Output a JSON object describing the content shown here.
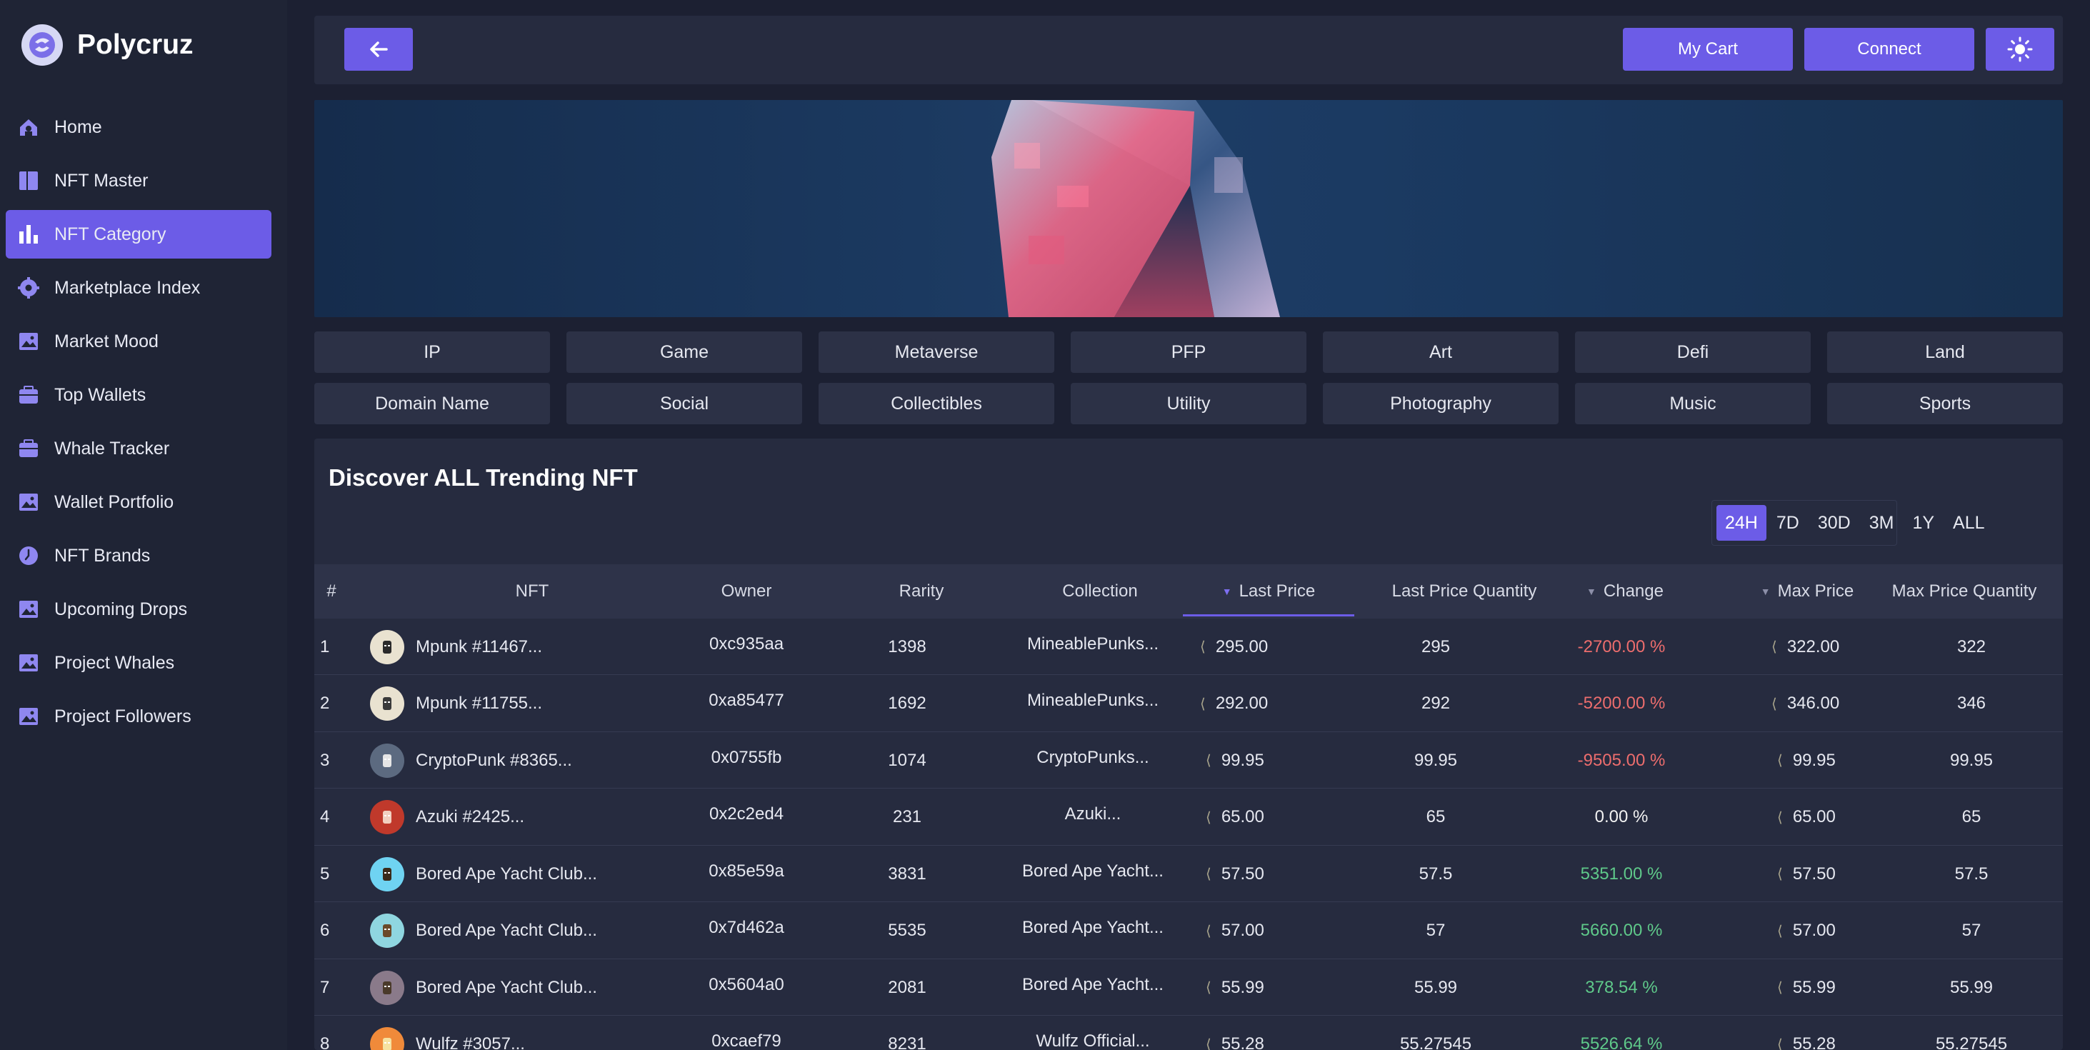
{
  "brand": {
    "name": "Polycruz"
  },
  "sidebar": {
    "items": [
      {
        "label": "Home",
        "icon": "home-icon"
      },
      {
        "label": "NFT Master",
        "icon": "grid-icon"
      },
      {
        "label": "NFT Category",
        "icon": "bar-chart-icon",
        "active": true
      },
      {
        "label": "Marketplace Index",
        "icon": "gear-icon"
      },
      {
        "label": "Market Mood",
        "icon": "image-icon"
      },
      {
        "label": "Top Wallets",
        "icon": "wallet-icon"
      },
      {
        "label": "Whale Tracker",
        "icon": "wallet-icon"
      },
      {
        "label": "Wallet Portfolio",
        "icon": "image-icon"
      },
      {
        "label": "NFT Brands",
        "icon": "clock-icon"
      },
      {
        "label": "Upcoming Drops",
        "icon": "image-icon"
      },
      {
        "label": "Project Whales",
        "icon": "image-icon"
      },
      {
        "label": "Project Followers",
        "icon": "image-icon"
      }
    ]
  },
  "topbar": {
    "cart_label": "My Cart",
    "connect_label": "Connect"
  },
  "categories": {
    "row1": [
      "IP",
      "Game",
      "Metaverse",
      "PFP",
      "Art",
      "Defi",
      "Land"
    ],
    "row2": [
      "Domain Name",
      "Social",
      "Collectibles",
      "Utility",
      "Photography",
      "Music",
      "Sports"
    ]
  },
  "trending": {
    "title": "Discover ALL Trending NFT",
    "periods": [
      "24H",
      "7D",
      "30D",
      "3M",
      "1Y",
      "ALL"
    ],
    "active_period": "24H",
    "columns": [
      "#",
      "NFT",
      "Owner",
      "Rarity",
      "Collection",
      "Last Price",
      "Last Price Quantity",
      "Change",
      "Max Price",
      "Max Price Quantity"
    ],
    "rows": [
      {
        "rank": "1",
        "nft": "Mpunk #11467...",
        "owner": "0xc935aa",
        "rarity": "1398",
        "collection": "MineablePunks...",
        "last_price": "295.00",
        "last_qty": "295",
        "change": "-2700.00 %",
        "max_price": "322.00",
        "max_qty": "322"
      },
      {
        "rank": "2",
        "nft": "Mpunk #11755...",
        "owner": "0xa85477",
        "rarity": "1692",
        "collection": "MineablePunks...",
        "last_price": "292.00",
        "last_qty": "292",
        "change": "-5200.00 %",
        "max_price": "346.00",
        "max_qty": "346"
      },
      {
        "rank": "3",
        "nft": "CryptoPunk #8365...",
        "owner": "0x0755fb",
        "rarity": "1074",
        "collection": "CryptoPunks...",
        "last_price": "99.95",
        "last_qty": "99.95",
        "change": "-9505.00 %",
        "max_price": "99.95",
        "max_qty": "99.95"
      },
      {
        "rank": "4",
        "nft": "Azuki #2425...",
        "owner": "0x2c2ed4",
        "rarity": "231",
        "collection": "Azuki...",
        "last_price": "65.00",
        "last_qty": "65",
        "change": "0.00 %",
        "max_price": "65.00",
        "max_qty": "65"
      },
      {
        "rank": "5",
        "nft": "Bored Ape Yacht Club...",
        "owner": "0x85e59a",
        "rarity": "3831",
        "collection": "Bored Ape Yacht...",
        "last_price": "57.50",
        "last_qty": "57.5",
        "change": "5351.00 %",
        "max_price": "57.50",
        "max_qty": "57.5"
      },
      {
        "rank": "6",
        "nft": "Bored Ape Yacht Club...",
        "owner": "0x7d462a",
        "rarity": "5535",
        "collection": "Bored Ape Yacht...",
        "last_price": "57.00",
        "last_qty": "57",
        "change": "5660.00 %",
        "max_price": "57.00",
        "max_qty": "57"
      },
      {
        "rank": "7",
        "nft": "Bored Ape Yacht Club...",
        "owner": "0x5604a0",
        "rarity": "2081",
        "collection": "Bored Ape Yacht...",
        "last_price": "55.99",
        "last_qty": "55.99",
        "change": "378.54 %",
        "max_price": "55.99",
        "max_qty": "55.99"
      },
      {
        "rank": "8",
        "nft": "Wulfz #3057...",
        "owner": "0xcaef79",
        "rarity": "8231",
        "collection": "Wulfz Official...",
        "last_price": "55.28",
        "last_qty": "55.27545",
        "change": "5526.64 %",
        "max_price": "55.28",
        "max_qty": "55.27545"
      }
    ]
  },
  "colors": {
    "accent": "#6c5ce7",
    "background": "#1c2032",
    "panel": "#262b3f",
    "negative": "#ec6d6d",
    "positive": "#5fc98a"
  }
}
